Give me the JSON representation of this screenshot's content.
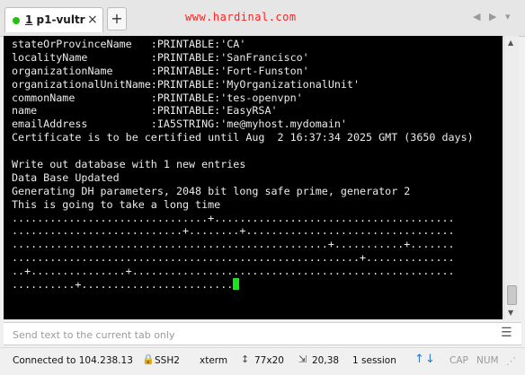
{
  "tab": {
    "number": "1",
    "name": "p1-vultr",
    "close_symbol": "×",
    "status_color": "#22c00f"
  },
  "new_tab_symbol": "+",
  "watermark": "www.hardinal.com",
  "terminal": {
    "lines": [
      "stateOrProvinceName   :PRINTABLE:'CA'",
      "localityName          :PRINTABLE:'SanFrancisco'",
      "organizationName      :PRINTABLE:'Fort-Funston'",
      "organizationalUnitName:PRINTABLE:'MyOrganizationalUnit'",
      "commonName            :PRINTABLE:'tes-openvpn'",
      "name                  :PRINTABLE:'EasyRSA'",
      "emailAddress          :IA5STRING:'me@myhost.mydomain'",
      "Certificate is to be certified until Aug  2 16:37:34 2025 GMT (3650 days)",
      "",
      "Write out database with 1 new entries",
      "Data Base Updated",
      "Generating DH parameters, 2048 bit long safe prime, generator 2",
      "This is going to take a long time",
      "...............................+......................................",
      "...........................+........+.................................",
      "..................................................+...........+.......",
      ".......................................................+..............",
      "..+...............+...................................................",
      "..........+........................"
    ],
    "cursor_color": "#19e619",
    "background": "#000000",
    "foreground": "#ebebeb"
  },
  "sendbar": {
    "placeholder": "Send text to the current tab only"
  },
  "status": {
    "connection": "Connected to 104.238.13",
    "protocol": "SSH2",
    "terminal_type": "xterm",
    "size": "77x20",
    "cursor_pos": "20,38",
    "sessions": "1 session",
    "cap": "CAP",
    "num": "NUM"
  }
}
